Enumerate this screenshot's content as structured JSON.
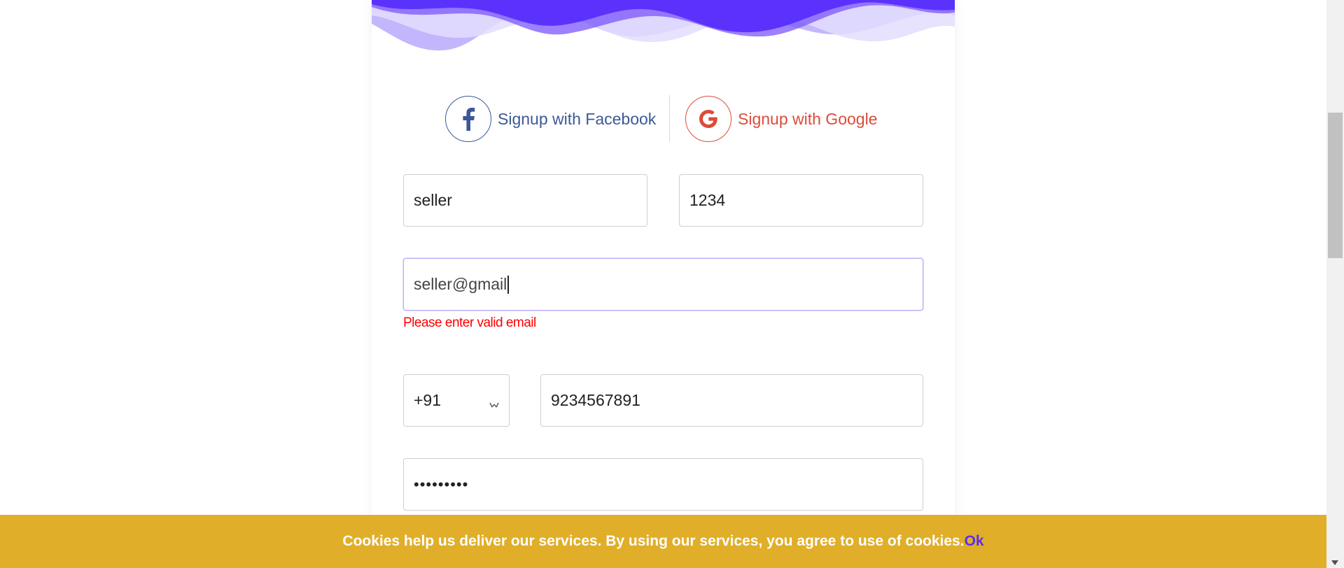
{
  "social": {
    "facebook_label": "Signup with Facebook",
    "google_label": "Signup with Google",
    "facebook_color": "#3b5998",
    "google_color": "#dd4b39"
  },
  "form": {
    "first_name_value": "seller",
    "last_name_value": "1234",
    "email_value": "seller@gmail",
    "email_error": "Please enter valid email",
    "country_code_value": "+91",
    "phone_value": "9234567891",
    "password_value": "•••••••••"
  },
  "cookie": {
    "message": "Cookies help us deliver our services. By using our services, you agree to use of cookies.",
    "ok_label": "Ok",
    "bar_color": "#e0ae28",
    "ok_color": "#5a2ff0"
  },
  "colors": {
    "header_wave": "#5b32fb",
    "error": "#ff0000"
  }
}
